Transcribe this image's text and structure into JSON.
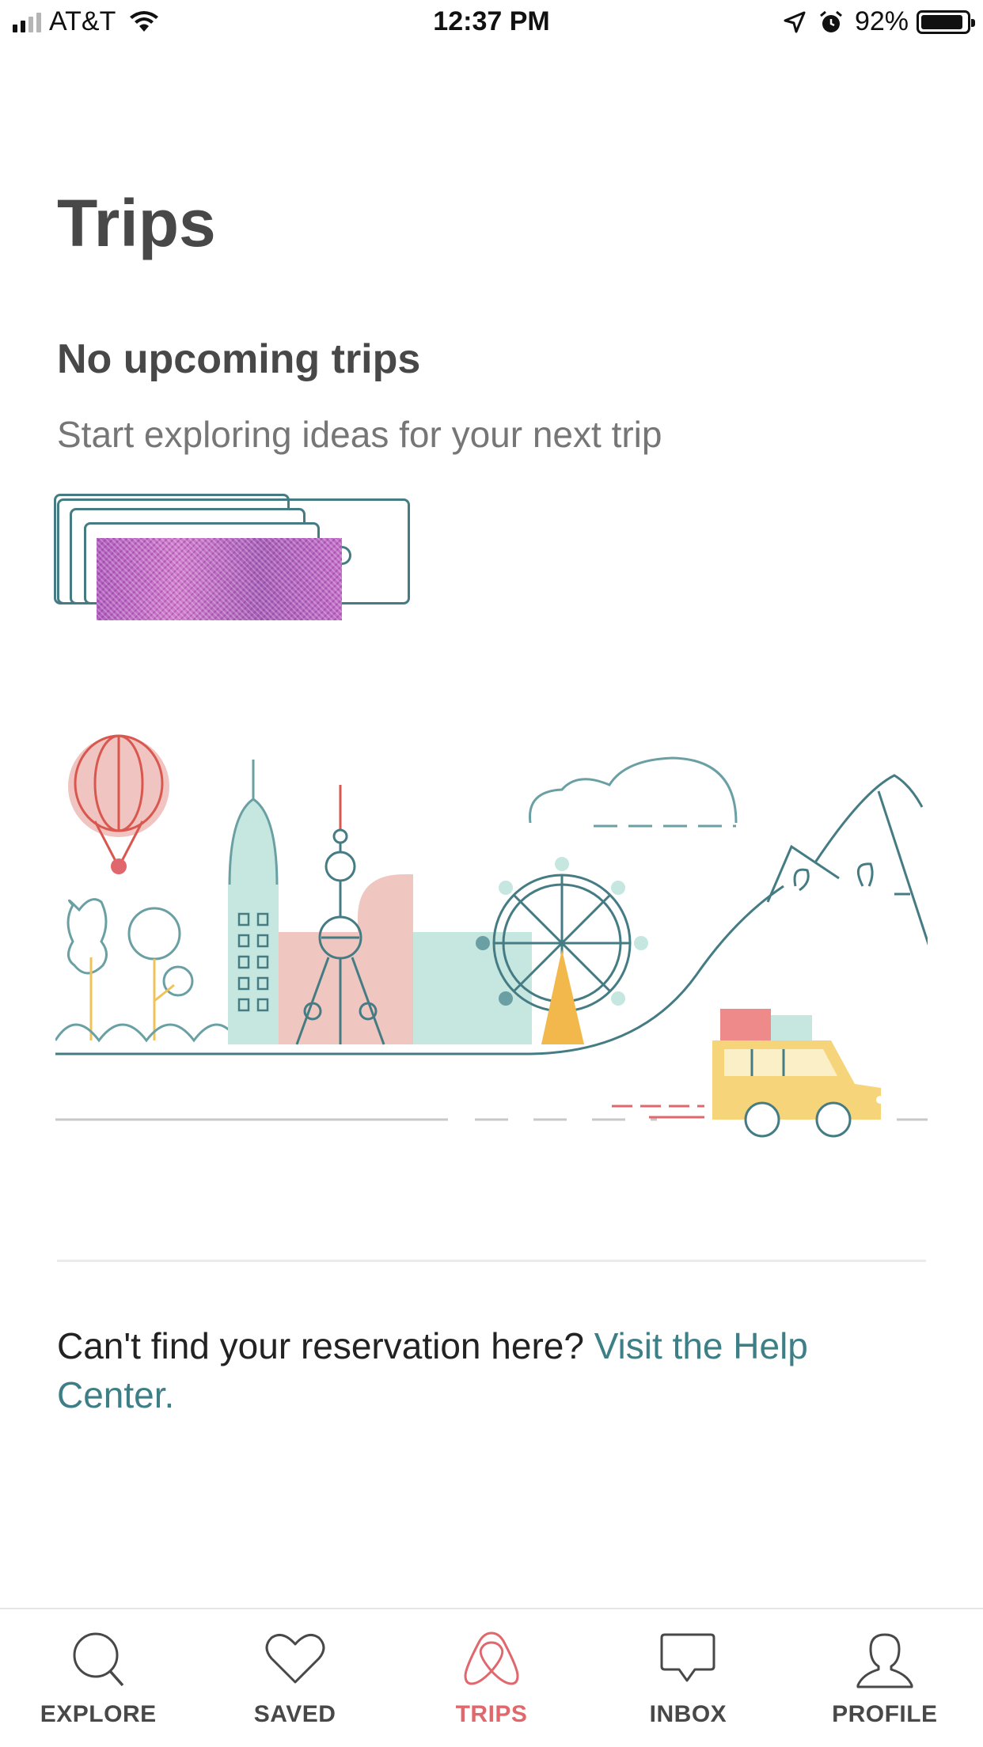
{
  "status_bar": {
    "carrier": "AT&T",
    "time": "12:37 PM",
    "battery_percent": "92%",
    "battery_level": 0.92,
    "signal_bars_filled": 2,
    "signal_bars_total": 4
  },
  "page": {
    "title": "Trips",
    "empty_title": "No upcoming trips",
    "empty_subtitle": "Start exploring ideas for your next trip"
  },
  "help": {
    "text": "Can't find your reservation here? ",
    "link": "Visit the Help Center."
  },
  "tabs": [
    {
      "label": "EXPLORE",
      "icon": "search-icon",
      "active": false
    },
    {
      "label": "SAVED",
      "icon": "heart-icon",
      "active": false
    },
    {
      "label": "TRIPS",
      "icon": "airbnb-logo-icon",
      "active": true
    },
    {
      "label": "INBOX",
      "icon": "chat-bubble-icon",
      "active": false
    },
    {
      "label": "PROFILE",
      "icon": "person-icon",
      "active": false
    }
  ],
  "colors": {
    "brand": "#FF5A5F",
    "active_tab": "#e0676c",
    "teal_link": "#3d7f86",
    "title_text": "#484848",
    "subtitle_text": "#767676"
  }
}
